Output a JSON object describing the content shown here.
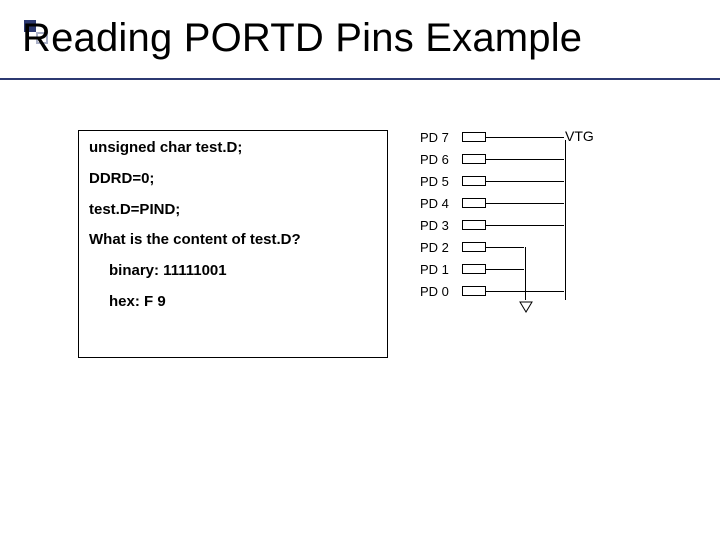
{
  "title": "Reading PORTD Pins Example",
  "code": {
    "l1": "unsigned char test.D;",
    "l2": "DDRD=0;",
    "l3": "test.D=PIND;",
    "l4": "What is the content of test.D?",
    "l5": "binary: 11111001",
    "l6": "hex: F 9"
  },
  "pins": {
    "p7": "PD 7",
    "p6": "PD 6",
    "p5": "PD 5",
    "p4": "PD 4",
    "p3": "PD 3",
    "p2": "PD 2",
    "p1": "PD 1",
    "p0": "PD 0"
  },
  "vtg": "VTG",
  "chart_data": {
    "type": "table",
    "title": "PORTD pin wiring to VTG",
    "pins": [
      "PD7",
      "PD6",
      "PD5",
      "PD4",
      "PD3",
      "PD2",
      "PD1",
      "PD0"
    ],
    "tied_to_vtg": [
      true,
      true,
      true,
      true,
      true,
      false,
      false,
      true
    ],
    "resulting_value_binary": "11111001",
    "resulting_value_hex": "F9"
  }
}
